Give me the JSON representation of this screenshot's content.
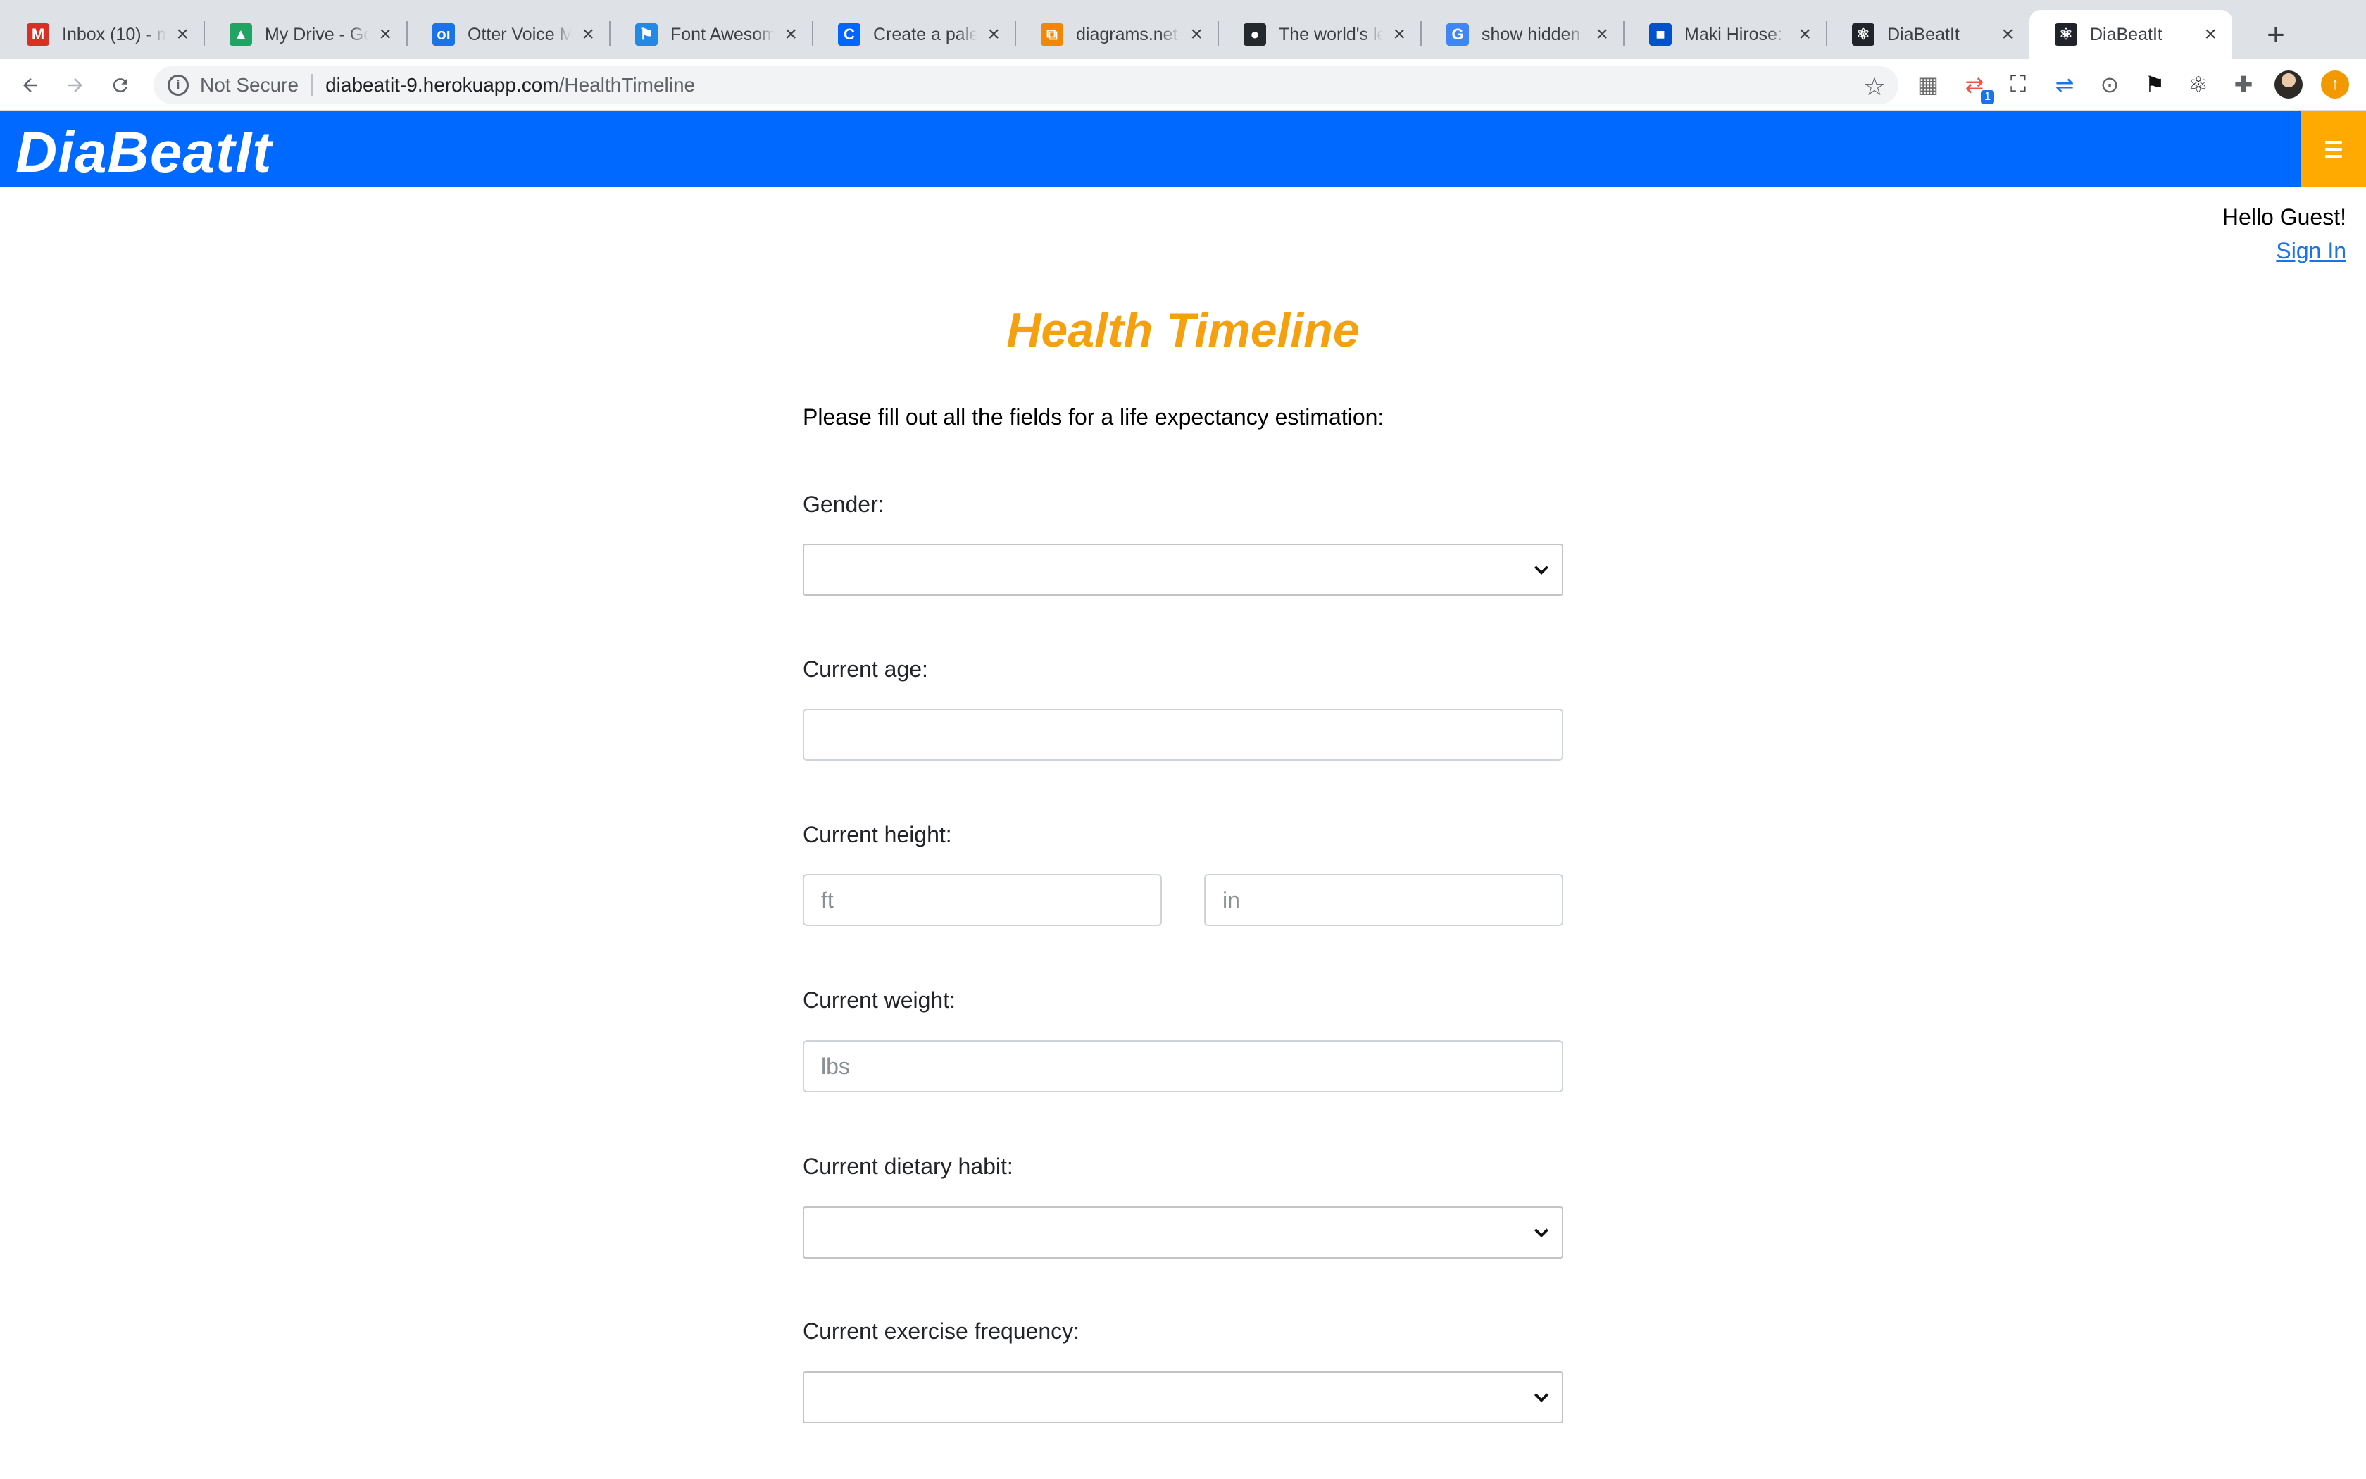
{
  "browser": {
    "tabs": [
      {
        "title": "Inbox (10) - m",
        "icon": "gmail-icon",
        "color": "#d93025",
        "glyph": "M"
      },
      {
        "title": "My Drive - Go",
        "icon": "google-drive-icon",
        "color": "#1fa463",
        "glyph": "▲"
      },
      {
        "title": "Otter Voice M",
        "icon": "otter-icon",
        "color": "#1a73e8",
        "glyph": "oı"
      },
      {
        "title": "Font Awesome",
        "icon": "font-awesome-flag-icon",
        "color": "#228ae6",
        "glyph": "⚑"
      },
      {
        "title": "Create a palet",
        "icon": "coolors-icon",
        "color": "#0066ff",
        "glyph": "C"
      },
      {
        "title": "diagrams.net",
        "icon": "diagrams-net-icon",
        "color": "#f08705",
        "glyph": "⧉"
      },
      {
        "title": "The world's le",
        "icon": "github-icon",
        "color": "#24292e",
        "glyph": "●"
      },
      {
        "title": "show hidden f",
        "icon": "google-icon",
        "color": "#4285f4",
        "glyph": "G"
      },
      {
        "title": "Maki Hirose: L",
        "icon": "trello-icon",
        "color": "#0052cc",
        "glyph": "■"
      },
      {
        "title": "DiaBeatIt",
        "icon": "react-icon",
        "color": "#20232a",
        "glyph": "⚛"
      },
      {
        "title": "DiaBeatIt",
        "icon": "react-icon",
        "color": "#20232a",
        "glyph": "⚛"
      }
    ],
    "active_tab": 10,
    "security_label": "Not Secure",
    "url_host": "diabeatit-9.herokuapp.com",
    "url_path": "/HealthTimeline",
    "extensions": [
      "dashboard-ext-icon",
      "share-ext-icon",
      "screenshot-ext-icon",
      "arrows-ext-icon",
      "code-ext-icon",
      "flag-ext-icon",
      "react-devtools-icon",
      "puzzle-extensions-icon",
      "profile-avatar",
      "update-icon"
    ],
    "extension_badge": "1"
  },
  "app": {
    "brand": "DiaBeatIt",
    "brand_color": "#0069ff",
    "menu_color": "#ffaa00",
    "greeting": "Hello Guest!",
    "signin": "Sign In"
  },
  "page": {
    "title": "Health Timeline",
    "title_color": "#f5a00f",
    "intro": "Please fill out all the fields for a life expectancy estimation:"
  },
  "form": {
    "gender": {
      "label": "Gender:",
      "value": ""
    },
    "age": {
      "label": "Current age:",
      "value": "",
      "placeholder": ""
    },
    "height": {
      "label": "Current height:",
      "ft_placeholder": "ft",
      "in_placeholder": "in"
    },
    "weight": {
      "label": "Current weight:",
      "placeholder": "lbs"
    },
    "diet": {
      "label": "Current dietary habit:",
      "value": ""
    },
    "exercise": {
      "label": "Current exercise frequency:",
      "value": ""
    }
  }
}
